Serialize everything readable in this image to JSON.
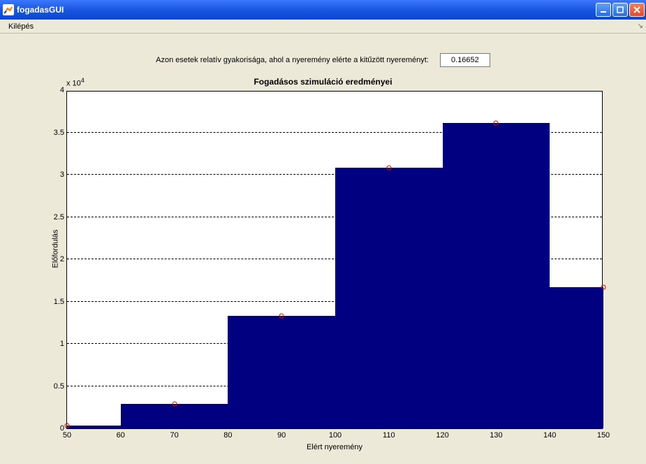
{
  "window": {
    "title": "fogadasGUI",
    "minimize_tooltip": "Minimize",
    "maximize_tooltip": "Restore",
    "close_tooltip": "Close"
  },
  "menu": {
    "exit": "Kilépés"
  },
  "header": {
    "label": "Azon esetek relatív gyakorisága, ahol a nyeremény elérte a kitűzött nyereményt:",
    "value": "0.16652"
  },
  "axis_exponent": "x 10^4",
  "chart_data": {
    "type": "bar",
    "title": "Fogadásos szimuláció eredményei",
    "xlabel": "Elért nyeremény",
    "ylabel": "Előfordulás",
    "y_scale_exponent": 4,
    "xlim": [
      50,
      150
    ],
    "ylim": [
      0,
      4
    ],
    "x_ticks": [
      50,
      60,
      70,
      80,
      90,
      100,
      110,
      120,
      130,
      140,
      150
    ],
    "y_ticks": [
      0,
      0.5,
      1,
      1.5,
      2,
      2.5,
      3,
      3.5,
      4
    ],
    "bars": [
      {
        "x_start": 50,
        "x_end": 60,
        "value": 0.03
      },
      {
        "x_start": 60,
        "x_end": 80,
        "value": 0.29
      },
      {
        "x_start": 80,
        "x_end": 100,
        "value": 1.33
      },
      {
        "x_start": 100,
        "x_end": 120,
        "value": 3.08
      },
      {
        "x_start": 120,
        "x_end": 140,
        "value": 3.61
      },
      {
        "x_start": 140,
        "x_end": 150,
        "value": 1.67
      }
    ],
    "markers": [
      {
        "x": 50,
        "y": 0.03
      },
      {
        "x": 70,
        "y": 0.29
      },
      {
        "x": 90,
        "y": 1.33
      },
      {
        "x": 110,
        "y": 3.08
      },
      {
        "x": 130,
        "y": 3.61
      },
      {
        "x": 150,
        "y": 1.67
      }
    ]
  }
}
